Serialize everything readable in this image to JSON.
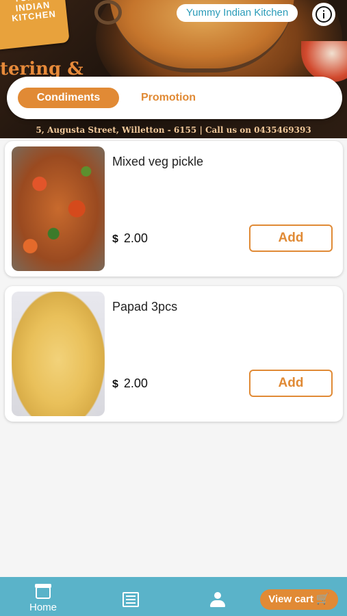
{
  "header": {
    "logo_text": "YUMMY INDIAN KITCHEN",
    "banner_text": "tering &",
    "store_name": "Yummy Indian Kitchen",
    "info_icon": "info-icon",
    "address": "5, Augusta Street, Willetton - 6155 | Call us on 0435469393"
  },
  "tabs": [
    {
      "label": "Condiments",
      "active": true
    },
    {
      "label": "Promotion",
      "active": false
    }
  ],
  "products": [
    {
      "name": "Mixed veg pickle",
      "currency": "$",
      "price": "2.00",
      "add_label": "Add"
    },
    {
      "name": "Papad 3pcs",
      "currency": "$",
      "price": "2.00",
      "add_label": "Add"
    }
  ],
  "bottom_nav": {
    "home_label": "Home",
    "home_icon": "store-icon",
    "menu_icon": "list-icon",
    "account_icon": "user-icon",
    "cart_label": "View cart",
    "cart_icon": "cart-icon"
  },
  "colors": {
    "accent": "#e18a35",
    "nav_bg": "#5ab3c9",
    "store_name_text": "#2a9bb8"
  }
}
